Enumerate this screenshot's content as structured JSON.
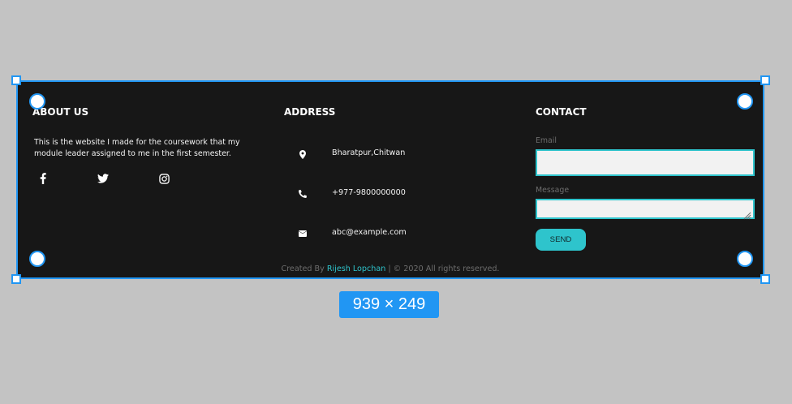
{
  "about": {
    "title": "ABOUT US",
    "text": "This is the website I made for the coursework that my module leader assigned to me in the first semester.",
    "social_icons": [
      "facebook-icon",
      "twitter-icon",
      "instagram-icon"
    ]
  },
  "address": {
    "title": "ADDRESS",
    "items": [
      {
        "icon": "map-marker-icon",
        "text": "Bharatpur,Chitwan"
      },
      {
        "icon": "phone-icon",
        "text": "+977-9800000000"
      },
      {
        "icon": "envelope-icon",
        "text": "abc@example.com"
      }
    ]
  },
  "contact": {
    "title": "CONTACT",
    "email_label": "Email",
    "email_value": "",
    "message_label": "Message",
    "message_value": "",
    "send_label": "SEND"
  },
  "footer": {
    "created_by": "Created By ",
    "author": "Rijesh Lopchan",
    "rights": " | © 2020 All rights reserved."
  },
  "selection": {
    "dimensions": "939 × 249"
  },
  "colors": {
    "background": "#171717",
    "accent": "#2ec4cc",
    "selection": "#2196f3"
  }
}
